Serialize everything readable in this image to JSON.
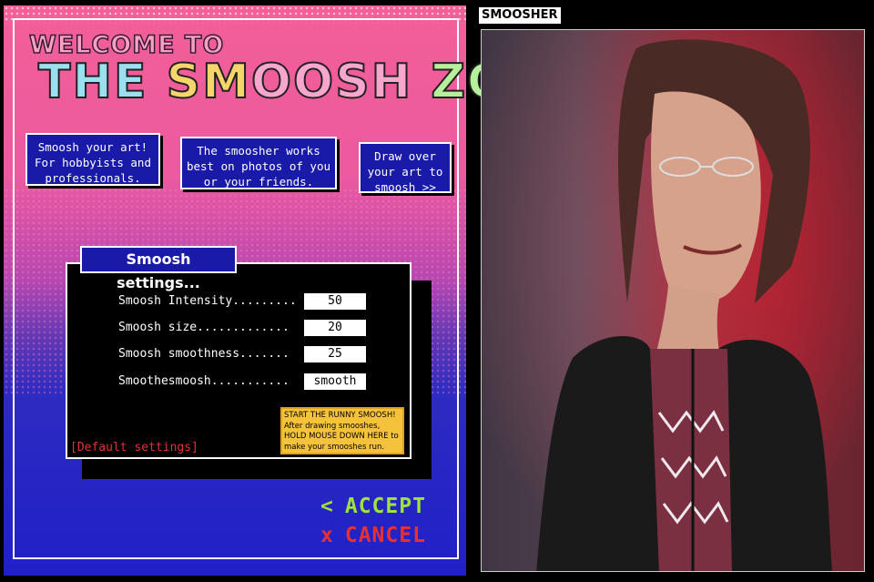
{
  "welcome": "WELCOME TO",
  "zone_title": {
    "a": "THE ",
    "b": "SM",
    "c": "OOSH ",
    "d": "ZONE!"
  },
  "info_boxes": [
    "Smoosh your art! For hobbyists and professionals.",
    "The smoosher works best on photos of you or your friends.",
    "Draw over your art to smoosh >>"
  ],
  "settings": {
    "title": "Smoosh settings...",
    "rows": [
      {
        "label": "Smoosh Intensity.........",
        "value": "50"
      },
      {
        "label": "Smoosh size.............",
        "value": "20"
      },
      {
        "label": "Smoosh smoothness.......",
        "value": "25"
      },
      {
        "label": "Smoothesmoosh...........",
        "value": "smooth"
      }
    ],
    "default_link": "[Default settings]",
    "runny_box": "START THE RUNNY SMOOSH! After drawing smooshes, HOLD MOUSE DOWN HERE to make your smooshes run."
  },
  "actions": {
    "accept_symbol": "<",
    "accept": "ACCEPT",
    "cancel_symbol": "x",
    "cancel": "CANCEL"
  },
  "right": {
    "label": "SMOOSHER"
  },
  "colors": {
    "accent_pink": "#f25f97",
    "accent_blue": "#1a1aa8",
    "accept": "#9ee23a",
    "cancel": "#e83030",
    "runny_bg": "#f5c33b"
  }
}
